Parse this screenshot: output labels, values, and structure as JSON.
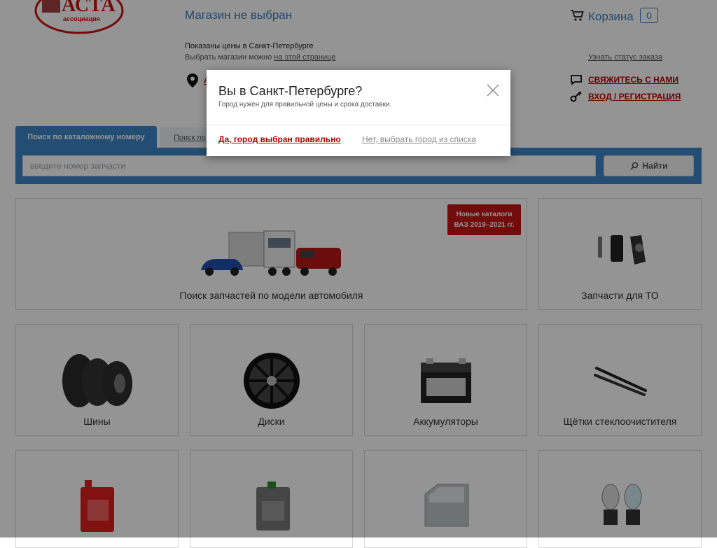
{
  "header": {
    "logo_text": "АСТА",
    "logo_sub": "ассоциация",
    "store_title": "Магазин не выбран",
    "prices_line": "Показаны цены в Санкт-Петербурге",
    "choose_prefix": "Выбрать магазин можно ",
    "choose_link": "на этой странице",
    "address_link": "А",
    "cart_label": "Корзина",
    "cart_count": "0",
    "order_status": "Узнать статус заказа",
    "contact_label": "СВЯЖИТЕСЬ С НАМИ",
    "login_label": "ВХОД / РЕГИСТРАЦИЯ"
  },
  "search": {
    "tab_active": "Поиск по каталожному номеру",
    "tab_inactive": "Поиск по",
    "placeholder": "введите номер запчасти",
    "button_label": "Найти"
  },
  "tiles": {
    "model_search": "Поиск запчастей по модели автомобиля",
    "badge_line1": "Новые каталоги",
    "badge_line2": "ВАЗ 2019–2021 гг.",
    "maintenance": "Запчасти для ТО",
    "tires": "Шины",
    "wheels": "Диски",
    "batteries": "Аккумуляторы",
    "wipers": "Щётки стеклоочистителя"
  },
  "modal": {
    "title": "Вы в Санкт-Петербурге?",
    "subtitle": "Город нужен для правильной цены и срока доставки.",
    "confirm": "Да, город выбран правильно",
    "decline": "Нет, выбрать город из списка"
  },
  "colors": {
    "accent_blue": "#3f86c6",
    "link_red": "#b00000",
    "badge_red": "#c41414"
  }
}
